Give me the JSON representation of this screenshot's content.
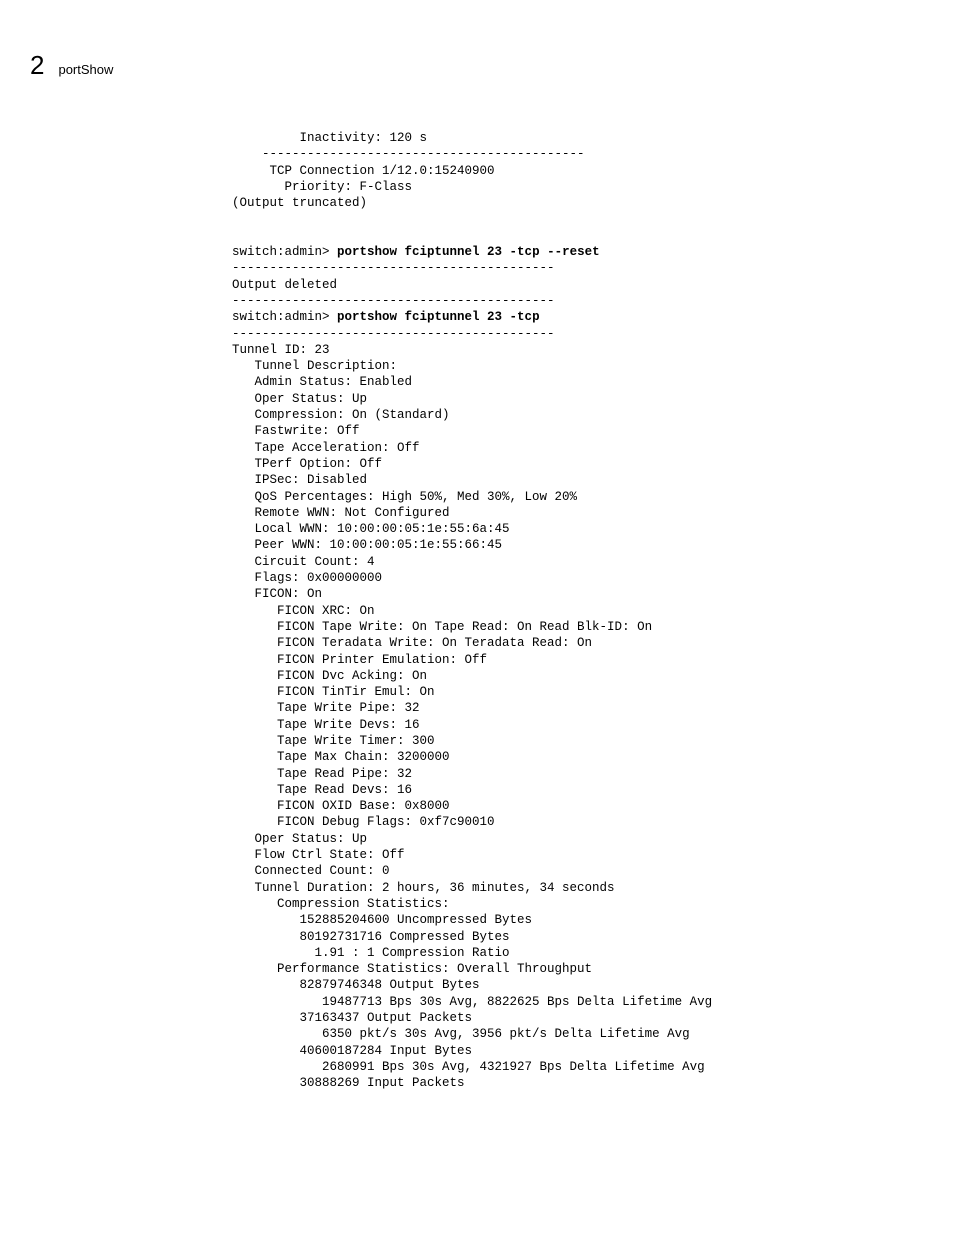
{
  "header": {
    "chapter": "2",
    "title": "portShow"
  },
  "block1": {
    "l1": "         Inactivity: 120 s",
    "l2": "    -------------------------------------------",
    "l3": "     TCP Connection 1/12.0:15240900",
    "l4": "       Priority: F-Class",
    "l5": "(Output truncated)"
  },
  "cmd1": {
    "prompt": "switch:admin> ",
    "cmd": "portshow fciptunnel 23 -tcp --reset"
  },
  "sep1": "-------------------------------------------",
  "deleted": "Output deleted",
  "sep2": "-------------------------------------------",
  "cmd2": {
    "prompt": "switch:admin> ",
    "cmd": "portshow fciptunnel 23 -tcp"
  },
  "sep3": "-------------------------------------------",
  "tunnel": {
    "l1": "Tunnel ID: 23",
    "l2": "   Tunnel Description:",
    "l3": "   Admin Status: Enabled",
    "l4": "   Oper Status: Up",
    "l5": "   Compression: On (Standard)",
    "l6": "   Fastwrite: Off",
    "l7": "   Tape Acceleration: Off",
    "l8": "   TPerf Option: Off",
    "l9": "   IPSec: Disabled",
    "l10": "   QoS Percentages: High 50%, Med 30%, Low 20%",
    "l11": "   Remote WWN: Not Configured",
    "l12": "   Local WWN: 10:00:00:05:1e:55:6a:45",
    "l13": "   Peer WWN: 10:00:00:05:1e:55:66:45",
    "l14": "   Circuit Count: 4",
    "l15": "   Flags: 0x00000000",
    "l16": "   FICON: On",
    "l17": "      FICON XRC: On",
    "l18": "      FICON Tape Write: On Tape Read: On Read Blk-ID: On",
    "l19": "      FICON Teradata Write: On Teradata Read: On",
    "l20": "      FICON Printer Emulation: Off",
    "l21": "      FICON Dvc Acking: On",
    "l22": "      FICON TinTir Emul: On",
    "l23": "      Tape Write Pipe: 32",
    "l24": "      Tape Write Devs: 16",
    "l25": "      Tape Write Timer: 300",
    "l26": "      Tape Max Chain: 3200000",
    "l27": "      Tape Read Pipe: 32",
    "l28": "      Tape Read Devs: 16",
    "l29": "      FICON OXID Base: 0x8000",
    "l30": "      FICON Debug Flags: 0xf7c90010",
    "l31": "   Oper Status: Up",
    "l32": "   Flow Ctrl State: Off",
    "l33": "   Connected Count: 0",
    "l34": "   Tunnel Duration: 2 hours, 36 minutes, 34 seconds",
    "l35": "      Compression Statistics:",
    "l36": "         152885204600 Uncompressed Bytes",
    "l37": "         80192731716 Compressed Bytes",
    "l38": "           1.91 : 1 Compression Ratio",
    "l39": "      Performance Statistics: Overall Throughput",
    "l40": "         82879746348 Output Bytes",
    "l41": "            19487713 Bps 30s Avg, 8822625 Bps Delta Lifetime Avg",
    "l42": "         37163437 Output Packets",
    "l43": "            6350 pkt/s 30s Avg, 3956 pkt/s Delta Lifetime Avg",
    "l44": "         40600187284 Input Bytes",
    "l45": "            2680991 Bps 30s Avg, 4321927 Bps Delta Lifetime Avg",
    "l46": "         30888269 Input Packets"
  }
}
